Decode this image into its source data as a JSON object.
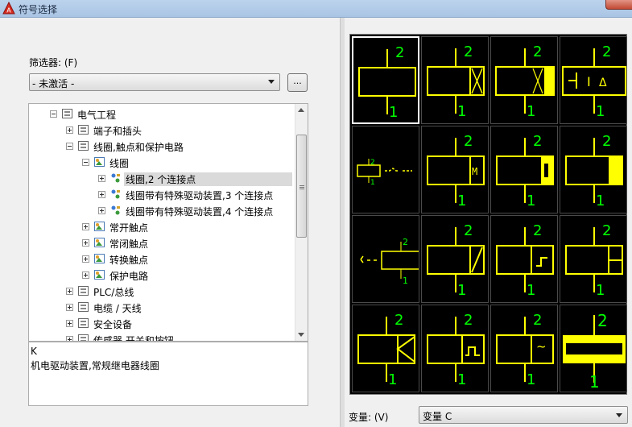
{
  "window": {
    "title": "符号选择"
  },
  "filter": {
    "label": "筛选器: (F)",
    "value": "- 未激活 -",
    "browse_label": "..."
  },
  "tree": {
    "nodes": [
      {
        "label": "电气工程",
        "icon": "catalog-icon",
        "expanded": true
      },
      {
        "label": "端子和插头",
        "icon": "catalog-icon",
        "expanded": false
      },
      {
        "label": "线圈,触点和保护电路",
        "icon": "catalog-icon",
        "expanded": true
      },
      {
        "label": "线圈",
        "icon": "group-icon",
        "expanded": true
      },
      {
        "label": "线圈,2 个连接点",
        "icon": "symbol-icon",
        "expanded": false,
        "selected": true
      },
      {
        "label": "线圈带有特殊驱动装置,3 个连接点",
        "icon": "symbol-icon",
        "expanded": false
      },
      {
        "label": "线圈带有特殊驱动装置,4 个连接点",
        "icon": "symbol-icon",
        "expanded": false
      },
      {
        "label": "常开触点",
        "icon": "group-icon",
        "expanded": false
      },
      {
        "label": "常闭触点",
        "icon": "group-icon",
        "expanded": false
      },
      {
        "label": "转换触点",
        "icon": "group-icon",
        "expanded": false
      },
      {
        "label": "保护电路",
        "icon": "group-icon",
        "expanded": false
      },
      {
        "label": "PLC/总线",
        "icon": "catalog-icon",
        "expanded": false
      },
      {
        "label": "电缆 / 天线",
        "icon": "catalog-icon",
        "expanded": false
      },
      {
        "label": "安全设备",
        "icon": "catalog-icon",
        "expanded": false
      },
      {
        "label": "传感器 开关和按钮",
        "icon": "catalog-icon",
        "expanded": false
      }
    ]
  },
  "description": {
    "line1": "K",
    "line2": "机电驱动装置,常规继电器线圈"
  },
  "symbol_grid": {
    "pin_top": "2",
    "pin_bottom": "1",
    "small_pin_top": "2",
    "small_pin_bottom": "1",
    "m_label": "M",
    "tilde": "~",
    "selected_index": 0,
    "cells": [
      "coil-plain",
      "coil-cross",
      "coil-cross-filled",
      "coil-delta",
      "coil-small-wave",
      "coil-m",
      "coil-filled-bar",
      "coil-filled-end",
      "coil-small-arrow",
      "coil-diagonal",
      "coil-step",
      "coil-grid",
      "coil-triangle",
      "coil-pulse",
      "coil-tilde",
      "coil-wide-filled"
    ]
  },
  "variant": {
    "label": "变量: (V)",
    "value": "变量 C"
  },
  "colors": {
    "symbol_stroke": "#ffff00",
    "pin_text": "#00ff00",
    "grid_bg": "#000000"
  }
}
